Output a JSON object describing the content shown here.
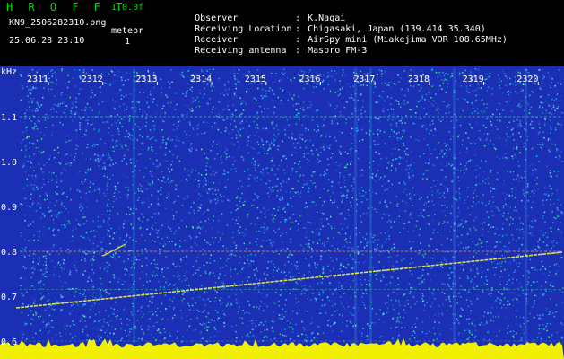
{
  "app": {
    "title": "H R O F F T",
    "version": "1.0.0f"
  },
  "file": {
    "name": "KN9_2506282310.png",
    "datetime": "25.06.28 23:10"
  },
  "meteor": {
    "label": "meteor",
    "count": "1"
  },
  "info": [
    {
      "key": "Observer",
      "value": "K.Nagai"
    },
    {
      "key": "Receiving Location",
      "value": "Chigasaki, Japan (139.414 35.340)"
    },
    {
      "key": "Receiver",
      "value": "AirSpy mini (Miakejima VOR 108.65MHz)"
    },
    {
      "key": "Receiving antenna",
      "value": "Maspro FM-3"
    }
  ],
  "axis": {
    "unit": "kHz",
    "freq_ticks": [
      "1.1",
      "1.0",
      "0.9",
      "0.8",
      "0.7",
      "0.6"
    ],
    "minute_ticks": [
      "2311",
      "2312",
      "2313",
      "2314",
      "2315",
      "2316",
      "2317",
      "2318",
      "2319",
      "2320"
    ]
  },
  "colors": {
    "background": "#1a2fb4",
    "noise_light": "#3fc8ff",
    "noise_cyan": "#00e0ff",
    "trace_yellow": "#ffff40",
    "trace_green": "#40ff80",
    "signal_red": "#ff4040",
    "baseline_yellow": "#f0f000",
    "title_green": "#00e000"
  }
}
